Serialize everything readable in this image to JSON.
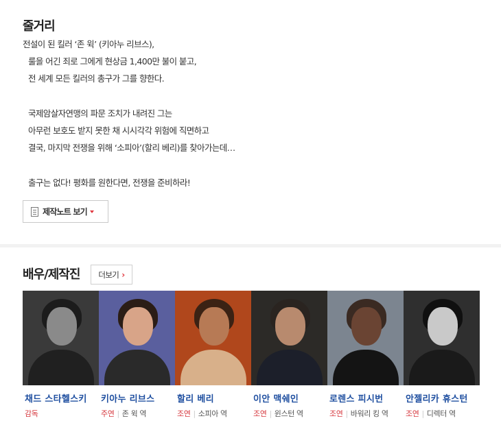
{
  "synopsis": {
    "title": "줄거리",
    "lines": [
      "전설이 된 킬러 ‘존 윅’ (키아누 리브스),",
      "룰을 어긴 죄로 그에게 현상금 1,400만 불이 붙고,",
      "전 세계 모든 킬러의 총구가 그를 향한다.",
      "",
      "국제암살자연맹의 파문 조치가 내려진 그는",
      "아무런 보호도 받지 못한 채 시시각각 위험에 직면하고",
      "결국, 마지막 전쟁을 위해 ‘소피아’(할리 베리)를 찾아가는데…",
      "",
      "출구는 없다! 평화를 원한다면, 전쟁을 준비하라!"
    ],
    "note_button_label": "제작노트 보기"
  },
  "cast": {
    "title": "배우/제작진",
    "more_label": "더보기",
    "members": [
      {
        "name": "채드 스타헬스키",
        "type": "감독",
        "role": "",
        "colors": {
          "bg": "#3a3a3a",
          "hair": "#1c1c1c",
          "skin": "#8a8a8a",
          "body": "#202020"
        }
      },
      {
        "name": "키아누 리브스",
        "type": "주연",
        "role": "존 윅 역",
        "colors": {
          "bg": "#5a5f9e",
          "hair": "#2b1d16",
          "skin": "#d8a488",
          "body": "#2a2a2a"
        }
      },
      {
        "name": "할리 베리",
        "type": "조연",
        "role": "소피아 역",
        "colors": {
          "bg": "#b0471c",
          "hair": "#3b2214",
          "skin": "#b77a55",
          "body": "#d8b08a"
        }
      },
      {
        "name": "이안 맥쉐인",
        "type": "조연",
        "role": "윈스턴 역",
        "colors": {
          "bg": "#2c2a27",
          "hair": "#2a2420",
          "skin": "#b88a6e",
          "body": "#1c1f2a"
        }
      },
      {
        "name": "로렌스 피시번",
        "type": "조연",
        "role": "바워리 킹 역",
        "colors": {
          "bg": "#7c8590",
          "hair": "#3a2a22",
          "skin": "#6a4433",
          "body": "#141414"
        }
      },
      {
        "name": "안젤리카 휴스턴",
        "type": "조연",
        "role": "디렉터 역",
        "colors": {
          "bg": "#2f2f2f",
          "hair": "#101010",
          "skin": "#c9c9c9",
          "body": "#1a1a1a"
        }
      }
    ]
  }
}
